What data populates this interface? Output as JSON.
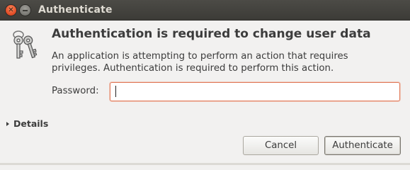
{
  "window": {
    "title": "Authenticate",
    "close_icon": "close-icon",
    "minimize_icon": "minimize-icon"
  },
  "dialog": {
    "icon": "keys-icon",
    "heading": "Authentication is required to change user data",
    "message": "An application is attempting to perform an action that requires privileges. Authentication is required to perform this action.",
    "password_label": "Password:",
    "password_value": "",
    "details_label": "Details",
    "cancel_label": "Cancel",
    "authenticate_label": "Authenticate"
  },
  "colors": {
    "titlebar": "#3c3b37",
    "close_button": "#e4502a",
    "input_focus_border": "#e07a5a",
    "background": "#f2f1f0"
  }
}
